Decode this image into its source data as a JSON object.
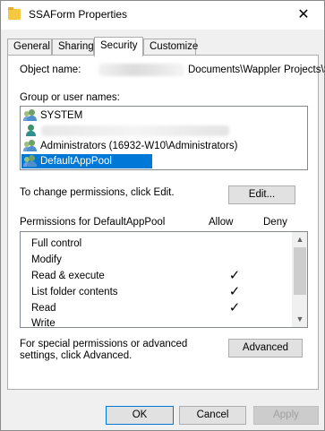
{
  "window": {
    "title": "SSAForm Properties",
    "close_glyph": "✕",
    "folder_icon_color": "#f5c842"
  },
  "tabs": [
    {
      "label": "General"
    },
    {
      "label": "Sharing"
    },
    {
      "label": "Security",
      "active": true
    },
    {
      "label": "Customize"
    }
  ],
  "security": {
    "object_label": "Object name:",
    "object_value_visible": "Documents\\Wappler Projects\\SS",
    "group_label": "Group or user names:",
    "groups": [
      {
        "name": "SYSTEM",
        "icon": "users-group-icon"
      },
      {
        "name": "",
        "icon": "user-icon",
        "redacted": true
      },
      {
        "name": "Administrators (16932-W10\\Administrators)",
        "icon": "users-group-icon"
      },
      {
        "name": "DefaultAppPool",
        "icon": "users-group-icon",
        "selected": true
      }
    ],
    "change_text": "To change permissions, click Edit.",
    "edit_button": "Edit...",
    "perm_header": "Permissions for DefaultAppPool",
    "allow_header": "Allow",
    "deny_header": "Deny",
    "permissions": [
      {
        "name": "Full control",
        "allow": false,
        "deny": false
      },
      {
        "name": "Modify",
        "allow": false,
        "deny": false
      },
      {
        "name": "Read & execute",
        "allow": true,
        "deny": false
      },
      {
        "name": "List folder contents",
        "allow": true,
        "deny": false
      },
      {
        "name": "Read",
        "allow": true,
        "deny": false
      },
      {
        "name": "Write",
        "allow": false,
        "deny": false
      }
    ],
    "check_glyph": "✓",
    "special_text": "For special permissions or advanced settings, click Advanced.",
    "advanced_button": "Advanced"
  },
  "footer": {
    "ok": "OK",
    "cancel": "Cancel",
    "apply": "Apply"
  },
  "colors": {
    "selection": "#0078d7",
    "ok_border": "#0078d7"
  }
}
